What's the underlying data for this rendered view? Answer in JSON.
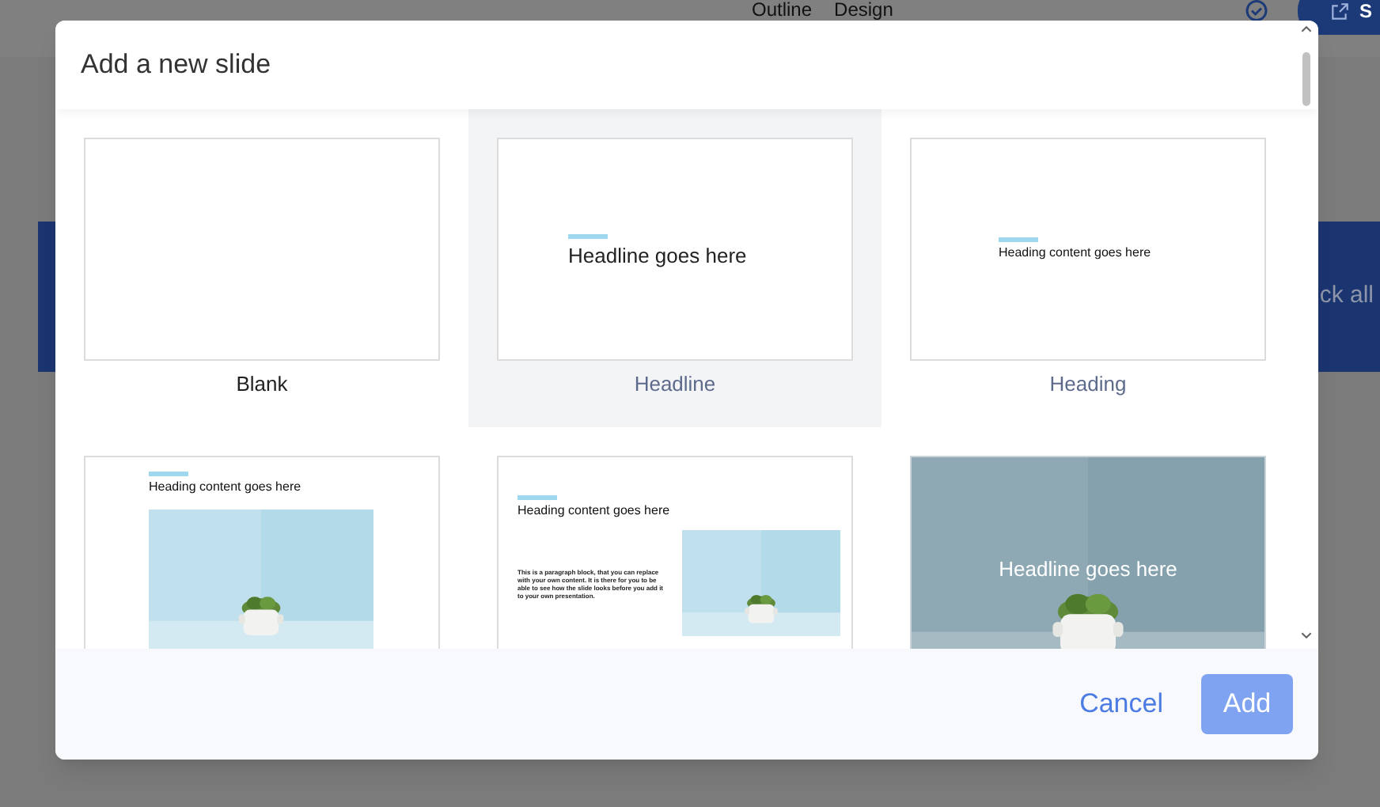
{
  "background": {
    "tabs": [
      "Outline",
      "Design"
    ],
    "banner_text": "ck all",
    "share_button": "S"
  },
  "dialog": {
    "title": "Add a new slide",
    "layouts": [
      {
        "kind": "blank",
        "label": "Blank",
        "selected": false
      },
      {
        "kind": "headline",
        "label": "Headline",
        "selected": true,
        "headline": "Headline goes here"
      },
      {
        "kind": "heading",
        "label": "Heading",
        "selected": false,
        "heading": "Heading content goes here"
      },
      {
        "kind": "heading-image",
        "selected": false,
        "heading": "Heading content goes here"
      },
      {
        "kind": "heading-text-image",
        "selected": false,
        "heading": "Heading content goes here",
        "paragraph": "This is a paragraph block, that you can replace with your own content. It is there for you to be able to see how the slide looks before you add it to your own presentation."
      },
      {
        "kind": "image-headline",
        "selected": false,
        "headline": "Headline goes here"
      }
    ],
    "buttons": {
      "cancel": "Cancel",
      "add": "Add"
    }
  }
}
